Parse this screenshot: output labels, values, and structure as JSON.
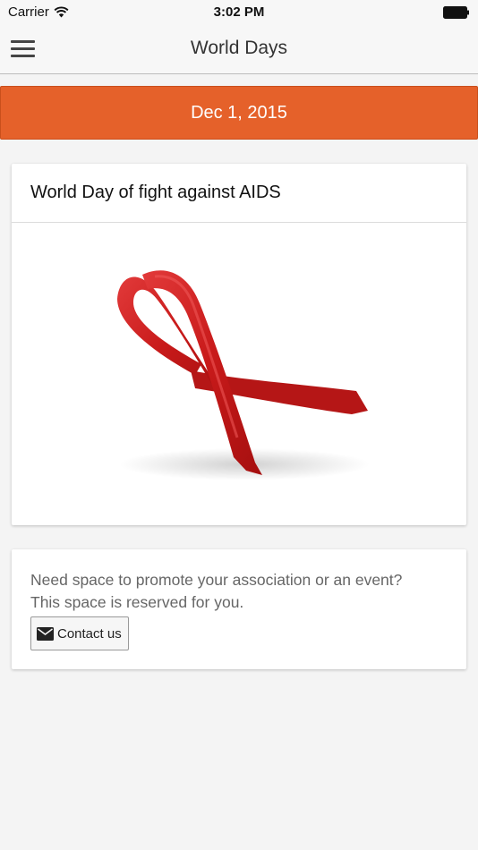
{
  "status_bar": {
    "carrier": "Carrier",
    "time": "3:02 PM"
  },
  "nav": {
    "title": "World Days",
    "menu_icon": "hamburger-menu-icon"
  },
  "date": {
    "label": "Dec 1, 2015",
    "color": "#e5612a"
  },
  "event": {
    "title": "World Day of fight against AIDS",
    "image": "red-ribbon-image"
  },
  "promo": {
    "line1": "Need space to promote your association or an event?",
    "line2": "This space is reserved for you.",
    "contact_label": "Contact us",
    "contact_icon": "envelope-icon"
  }
}
